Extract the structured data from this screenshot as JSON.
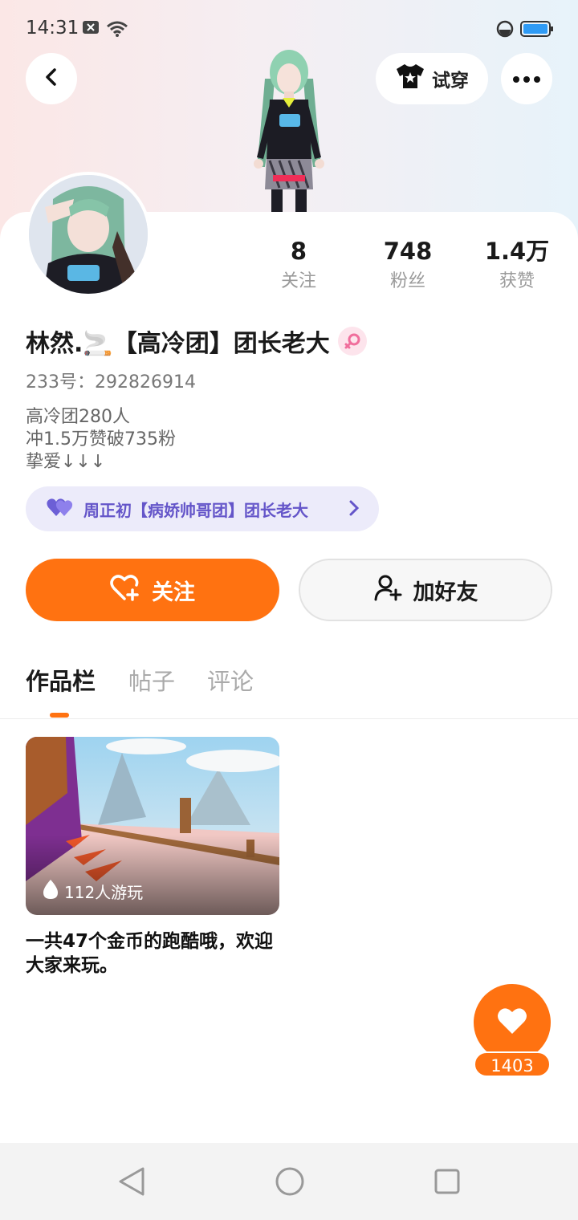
{
  "status_bar": {
    "time": "14:31"
  },
  "header": {
    "tryon_label": "试穿"
  },
  "colors": {
    "accent": "#ff7211",
    "team_pill_text": "#6455c9"
  },
  "profile": {
    "stats": [
      {
        "value": "8",
        "label": "关注"
      },
      {
        "value": "748",
        "label": "粉丝"
      },
      {
        "value": "1.4万",
        "label": "获赞"
      }
    ],
    "name": "林然.🚬【高冷团】团长老大",
    "uid": "233号：292826914",
    "bio": [
      "高冷团280人",
      "冲1.5万赞破735粉",
      "挚爱↓↓↓"
    ],
    "team_pill": "周正初【病娇帅哥团】团长老大"
  },
  "actions": {
    "follow_label": "关注",
    "add_friend_label": "加好友"
  },
  "tabs": [
    {
      "label": "作品栏",
      "active": true
    },
    {
      "label": "帖子",
      "active": false
    },
    {
      "label": "评论",
      "active": false
    }
  ],
  "works": [
    {
      "plays": "112人游玩",
      "title": "一共47个金币的跑酷哦，欢迎大家来玩。"
    }
  ],
  "like_fab": {
    "count": "1403"
  },
  "icons": [
    "back-icon",
    "tshirt-icon",
    "more-icon",
    "heart-plus-icon",
    "add-user-icon",
    "heart-icon",
    "flame-icon",
    "chevron-right-icon"
  ]
}
